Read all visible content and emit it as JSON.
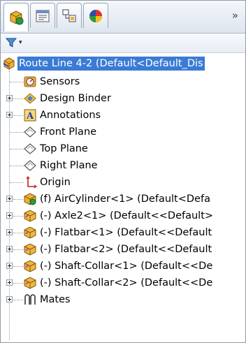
{
  "tabs": [
    {
      "icon": "feature-manager-icon",
      "active": true
    },
    {
      "icon": "property-manager-icon",
      "active": false
    },
    {
      "icon": "configuration-manager-icon",
      "active": false
    },
    {
      "icon": "display-manager-icon",
      "active": false
    }
  ],
  "overflow_label": "»",
  "filter": {
    "icon": "filter-icon",
    "dropdown_glyph": "▾"
  },
  "tree": {
    "root": {
      "label": "Route Line 4-2  (Default<Default_Dis",
      "icon": "route-assembly-icon",
      "selected": true
    },
    "items": [
      {
        "label": "Sensors",
        "icon": "sensors-icon",
        "expandable": false
      },
      {
        "label": "Design Binder",
        "icon": "design-binder-icon",
        "expandable": true
      },
      {
        "label": "Annotations",
        "icon": "annotations-icon",
        "expandable": true
      },
      {
        "label": "Front Plane",
        "icon": "plane-icon",
        "expandable": false
      },
      {
        "label": "Top Plane",
        "icon": "plane-icon",
        "expandable": false
      },
      {
        "label": "Right Plane",
        "icon": "plane-icon",
        "expandable": false
      },
      {
        "label": "Origin",
        "icon": "origin-icon",
        "expandable": false
      },
      {
        "label": "(f) AirCylinder<1> (Default<Defa",
        "icon": "assembly-component-icon",
        "expandable": true
      },
      {
        "label": "(-) Axle2<1> (Default<<Default>",
        "icon": "part-component-icon",
        "expandable": true
      },
      {
        "label": "(-) Flatbar<1> (Default<<Default",
        "icon": "part-component-icon",
        "expandable": true
      },
      {
        "label": "(-) Flatbar<2> (Default<<Default",
        "icon": "part-component-icon",
        "expandable": true
      },
      {
        "label": "(-) Shaft-Collar<1> (Default<<De",
        "icon": "part-component-icon",
        "expandable": true
      },
      {
        "label": "(-) Shaft-Collar<2> (Default<<De",
        "icon": "part-component-icon",
        "expandable": true
      },
      {
        "label": "Mates",
        "icon": "mates-icon",
        "expandable": true
      }
    ]
  },
  "colors": {
    "selection": "#3a7bd5",
    "tab_border": "#9aa7b8"
  }
}
